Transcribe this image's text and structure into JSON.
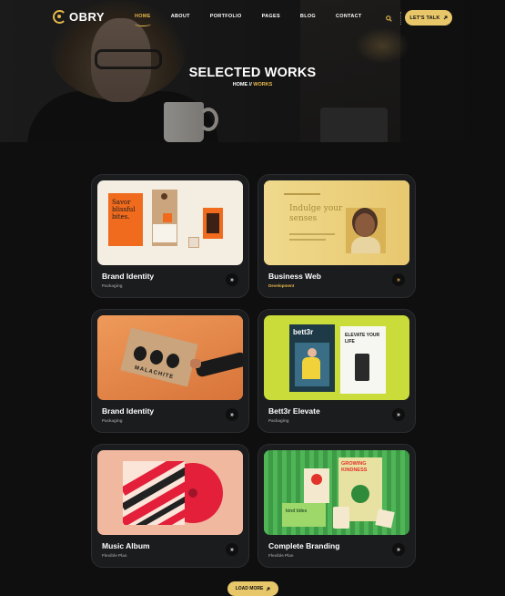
{
  "brand": {
    "name": "OBRY",
    "accent": "#e7b84a"
  },
  "nav": {
    "items": [
      {
        "label": "HOME",
        "active": true
      },
      {
        "label": "ABOUT",
        "active": false
      },
      {
        "label": "PORTFOLIO",
        "active": false
      },
      {
        "label": "PAGES",
        "active": false
      },
      {
        "label": "BLOG",
        "active": false
      },
      {
        "label": "CONTACT",
        "active": false
      }
    ],
    "search_icon": "search-icon",
    "cta_label": "LET'S TALK",
    "cta_icon": "arrow-up-right-icon"
  },
  "hero": {
    "title": "SELECTED WORKS",
    "breadcrumb": {
      "home": "HOME",
      "separator": "//",
      "current": "WORKS"
    }
  },
  "works": [
    {
      "title": "Brand Identity",
      "category": "Packaging",
      "highlight": false,
      "thumb_text": "Savor blissful bites."
    },
    {
      "title": "Business Web",
      "category": "Development",
      "highlight": true,
      "thumb_text": "Indulge your senses"
    },
    {
      "title": "Brand Identity",
      "category": "Packaging",
      "highlight": false,
      "thumb_text": "MALACHITE"
    },
    {
      "title": "Bett3r Elevate",
      "category": "Packaging",
      "highlight": false,
      "thumb_text": "bett3r",
      "thumb_text_2": "ELEVATE YOUR LIFE"
    },
    {
      "title": "Music Album",
      "category": "Flexible Plan",
      "highlight": false
    },
    {
      "title": "Complete Branding",
      "category": "Flexible Plan",
      "highlight": false,
      "thumb_text": "GROWING KINDNESS",
      "thumb_text_2": "kind tides"
    }
  ],
  "arrow_glyph": "»",
  "load_more": {
    "label": "LOAD MORE",
    "icon": "arrow-up-right-icon"
  }
}
